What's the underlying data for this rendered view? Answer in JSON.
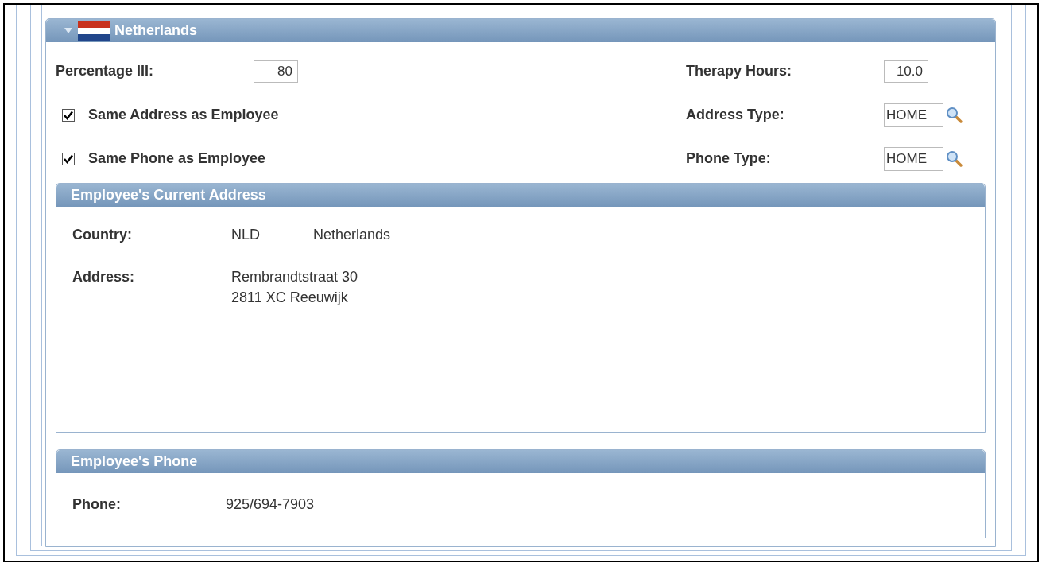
{
  "section": {
    "title": "Netherlands",
    "expanded": true
  },
  "rows": [
    {
      "left": {
        "kind": "input",
        "label": "Percentage III:",
        "value": "80"
      },
      "right": {
        "kind": "input",
        "label": "Therapy Hours:",
        "value": "10.0"
      }
    },
    {
      "left": {
        "kind": "checkbox",
        "label": "Same Address as Employee",
        "checked": true
      },
      "right": {
        "kind": "lookup",
        "label": "Address Type:",
        "value": "HOME"
      }
    },
    {
      "left": {
        "kind": "checkbox",
        "label": "Same Phone as Employee",
        "checked": true
      },
      "right": {
        "kind": "lookup",
        "label": "Phone Type:",
        "value": "HOME"
      }
    }
  ],
  "address_box": {
    "title": "Employee's Current Address",
    "country_label": "Country:",
    "country_code": "NLD",
    "country_name": "Netherlands",
    "address_label": "Address:",
    "address_lines": [
      "Rembrandtstraat 30",
      "2811 XC Reeuwijk"
    ]
  },
  "phone_box": {
    "title": "Employee's Phone",
    "label": "Phone:",
    "value": "925/694-7903"
  }
}
